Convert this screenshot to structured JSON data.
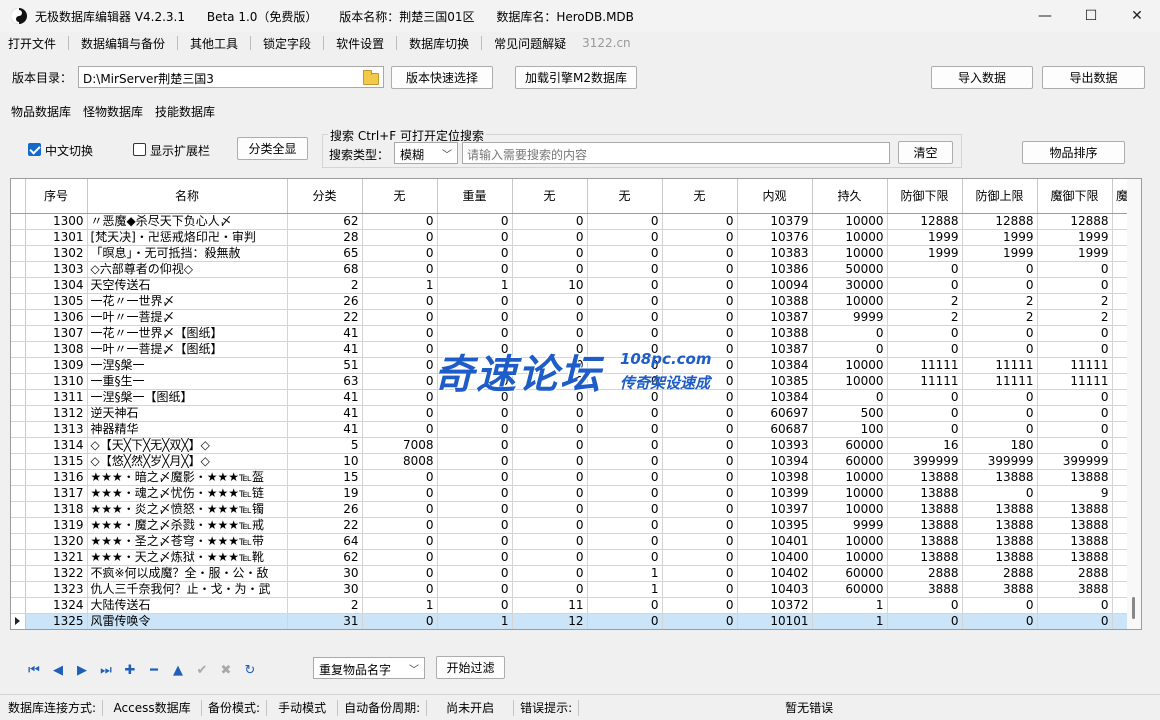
{
  "window": {
    "app_name": "无极数据库编辑器 V4.2.3.1",
    "edition": "Beta 1.0（免费版）",
    "version_label": "版本名称：荆楚三国01区",
    "db_label": "数据库名：HeroDB.MDB",
    "minimize": "—",
    "maximize": "☐",
    "close": "✕"
  },
  "menu": {
    "items": [
      "打开文件",
      "数据编辑与备份",
      "其他工具",
      "锁定字段",
      "软件设置",
      "数据库切换",
      "常见问题解疑"
    ],
    "site": "3122.cn"
  },
  "dirbar": {
    "label": "版本目录：",
    "path": "D:\\MirServer荆楚三国3",
    "quick_select": "版本快速选择",
    "load_engine": "加载引擎M2数据库",
    "import": "导入数据",
    "export": "导出数据"
  },
  "tabs": [
    "物品数据库",
    "怪物数据库",
    "技能数据库"
  ],
  "options": {
    "chinese_switch": "中文切换",
    "show_extend": "显示扩展栏",
    "show_all": "分类全显",
    "search_title": "搜索  Ctrl+F 可打开定位搜索",
    "search_type_label": "搜索类型：",
    "search_type": "模糊",
    "search_placeholder": "请输入需要搜索的内容",
    "clear": "清空",
    "sort": "物品排序"
  },
  "table": {
    "columns": [
      "序号",
      "名称",
      "分类",
      "无",
      "重量",
      "无",
      "无",
      "无",
      "内观",
      "持久",
      "防御下限",
      "防御上限",
      "魔御下限",
      "魔"
    ],
    "rows": [
      [
        "1300",
        "〃恶魔◆杀尽天下负心人〆",
        "62",
        "0",
        "0",
        "0",
        "0",
        "0",
        "10379",
        "10000",
        "12888",
        "12888",
        "12888"
      ],
      [
        "1301",
        "[梵天决]・卍惩戒烙印卍・审判",
        "28",
        "0",
        "0",
        "0",
        "0",
        "0",
        "10376",
        "10000",
        "1999",
        "1999",
        "1999"
      ],
      [
        "1302",
        "「暝息」・无可抵挡：殺無赦",
        "65",
        "0",
        "0",
        "0",
        "0",
        "0",
        "10383",
        "10000",
        "1999",
        "1999",
        "1999"
      ],
      [
        "1303",
        "◇六部尊者の仰视◇",
        "68",
        "0",
        "0",
        "0",
        "0",
        "0",
        "10386",
        "50000",
        "0",
        "0",
        "0"
      ],
      [
        "1304",
        "天空传送石",
        "2",
        "1",
        "1",
        "10",
        "0",
        "0",
        "10094",
        "30000",
        "0",
        "0",
        "0"
      ],
      [
        "1305",
        "一花〃一世界〆",
        "26",
        "0",
        "0",
        "0",
        "0",
        "0",
        "10388",
        "10000",
        "2",
        "2",
        "2"
      ],
      [
        "1306",
        "一叶〃一菩提〆",
        "22",
        "0",
        "0",
        "0",
        "0",
        "0",
        "10387",
        "9999",
        "2",
        "2",
        "2"
      ],
      [
        "1307",
        "一花〃一世界〆【图纸】",
        "41",
        "0",
        "0",
        "0",
        "0",
        "0",
        "10388",
        "0",
        "0",
        "0",
        "0"
      ],
      [
        "1308",
        "一叶〃一菩提〆【图纸】",
        "41",
        "0",
        "0",
        "0",
        "0",
        "0",
        "10387",
        "0",
        "0",
        "0",
        "0"
      ],
      [
        "1309",
        "一涅§槃一",
        "51",
        "0",
        "0",
        "0",
        "0",
        "0",
        "10384",
        "10000",
        "11111",
        "11111",
        "11111"
      ],
      [
        "1310",
        "一重§生一",
        "63",
        "0",
        "0",
        "0",
        "0",
        "0",
        "10385",
        "10000",
        "11111",
        "11111",
        "11111"
      ],
      [
        "1311",
        "一涅§槃一【图纸】",
        "41",
        "0",
        "0",
        "0",
        "0",
        "0",
        "10384",
        "0",
        "0",
        "0",
        "0"
      ],
      [
        "1312",
        "逆天神石",
        "41",
        "0",
        "0",
        "0",
        "0",
        "0",
        "60697",
        "500",
        "0",
        "0",
        "0"
      ],
      [
        "1313",
        "神器精华",
        "41",
        "0",
        "0",
        "0",
        "0",
        "0",
        "60687",
        "100",
        "0",
        "0",
        "0"
      ],
      [
        "1314",
        "◇【天╳下╳无╳双╳】◇",
        "5",
        "7008",
        "0",
        "0",
        "0",
        "0",
        "10393",
        "60000",
        "16",
        "180",
        "0"
      ],
      [
        "1315",
        "◇【悠╳然╳岁╳月╳】◇",
        "10",
        "8008",
        "0",
        "0",
        "0",
        "0",
        "10394",
        "60000",
        "399999",
        "399999",
        "399999"
      ],
      [
        "1316",
        "★★★・暗之〆魔影・★★★℡盔",
        "15",
        "0",
        "0",
        "0",
        "0",
        "0",
        "10398",
        "10000",
        "13888",
        "13888",
        "13888"
      ],
      [
        "1317",
        "★★★・魂之〆忧伤・★★★℡链",
        "19",
        "0",
        "0",
        "0",
        "0",
        "0",
        "10399",
        "10000",
        "13888",
        "0",
        "9"
      ],
      [
        "1318",
        "★★★・炎之〆愤怒・★★★℡镯",
        "26",
        "0",
        "0",
        "0",
        "0",
        "0",
        "10397",
        "10000",
        "13888",
        "13888",
        "13888"
      ],
      [
        "1319",
        "★★★・魔之〆杀戮・★★★℡戒",
        "22",
        "0",
        "0",
        "0",
        "0",
        "0",
        "10395",
        "9999",
        "13888",
        "13888",
        "13888"
      ],
      [
        "1320",
        "★★★・圣之〆苍穹・★★★℡带",
        "64",
        "0",
        "0",
        "0",
        "0",
        "0",
        "10401",
        "10000",
        "13888",
        "13888",
        "13888"
      ],
      [
        "1321",
        "★★★・天之〆炼狱・★★★℡靴",
        "62",
        "0",
        "0",
        "0",
        "0",
        "0",
        "10400",
        "10000",
        "13888",
        "13888",
        "13888"
      ],
      [
        "1322",
        "不疯※何以成魔？全・服・公・敌",
        "30",
        "0",
        "0",
        "0",
        "1",
        "0",
        "10402",
        "60000",
        "2888",
        "2888",
        "2888"
      ],
      [
        "1323",
        "仇人三千奈我何？止・戈・为・武",
        "30",
        "0",
        "0",
        "0",
        "1",
        "0",
        "10403",
        "60000",
        "3888",
        "3888",
        "3888"
      ],
      [
        "1324",
        "大陆传送石",
        "2",
        "1",
        "0",
        "11",
        "0",
        "0",
        "10372",
        "1",
        "0",
        "0",
        "0"
      ],
      [
        "1325",
        "风雷传唤令",
        "31",
        "0",
        "1",
        "12",
        "0",
        "0",
        "10101",
        "1",
        "0",
        "0",
        "0"
      ]
    ]
  },
  "watermark": {
    "main": "奇速论坛",
    "site": "108pc.com",
    "sub": "传奇架设速成"
  },
  "bottom": {
    "filter_select": "重复物品名字",
    "filter_button": "开始过滤"
  },
  "status": {
    "conn_label": "数据库连接方式:",
    "conn_value": "Access数据库",
    "backup_label": "备份模式:",
    "backup_value": "手动模式",
    "auto_label": "自动备份周期:",
    "auto_value": "尚未开启",
    "error_label": "错误提示:",
    "error_value": "暂无错误"
  }
}
